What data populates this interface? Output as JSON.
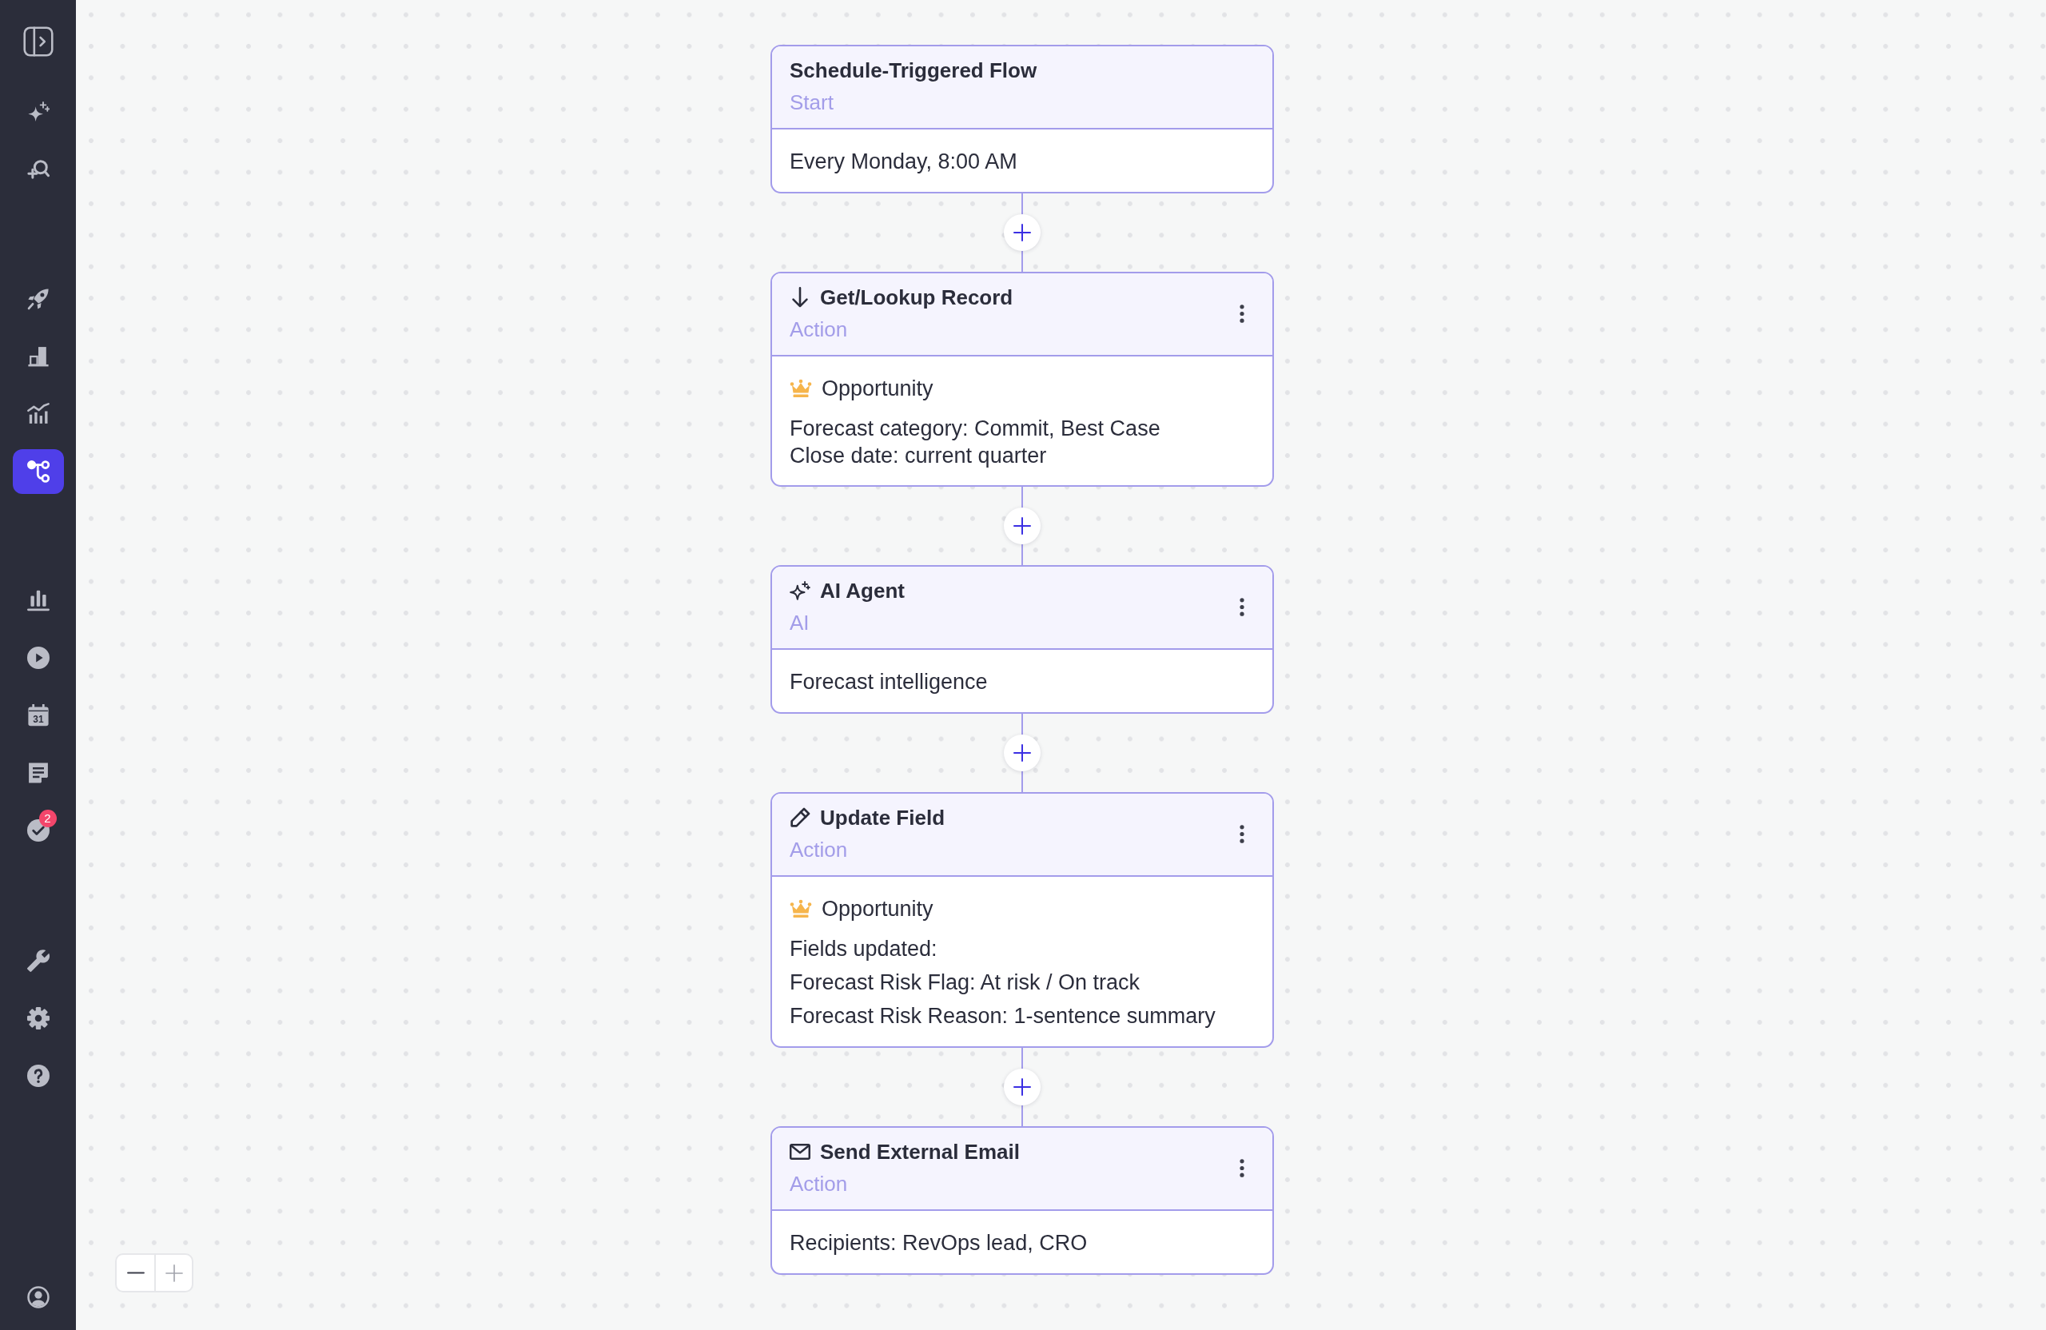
{
  "sidebar": {
    "groups": [
      {
        "items": [
          {
            "kind": "panel_toggle",
            "selected": false
          }
        ]
      },
      {
        "items": [
          {
            "kind": "ai_assistant",
            "selected": false
          },
          {
            "kind": "search_add",
            "selected": false
          }
        ]
      },
      {
        "items": [
          {
            "kind": "launch",
            "selected": false
          },
          {
            "kind": "reports",
            "selected": false
          },
          {
            "kind": "analytics",
            "selected": false
          },
          {
            "kind": "workflows",
            "selected": true
          }
        ]
      },
      {
        "items": [
          {
            "kind": "dashboards",
            "selected": false
          },
          {
            "kind": "recordings",
            "selected": false
          },
          {
            "kind": "calendar",
            "selected": false,
            "icon_text": "31"
          },
          {
            "kind": "notes",
            "selected": false
          },
          {
            "kind": "tasks",
            "selected": false,
            "badge": "2"
          }
        ]
      },
      {
        "items": [
          {
            "kind": "tools",
            "selected": false
          },
          {
            "kind": "settings",
            "selected": false
          },
          {
            "kind": "help",
            "selected": false
          }
        ]
      },
      {
        "items": [
          {
            "kind": "account",
            "selected": false
          }
        ]
      }
    ]
  },
  "flow": {
    "nodes": [
      {
        "kind": "trigger",
        "title": "Schedule-Triggered Flow",
        "type_label": "Start",
        "summary": "Every Monday, 8:00 AM"
      },
      {
        "kind": "lookup",
        "title": "Get/Lookup Record",
        "type_label": "Action",
        "record": "Opportunity",
        "filters": [
          "Forecast category: Commit, Best Case",
          "Close date: current quarter"
        ]
      },
      {
        "kind": "ai",
        "title": "AI Agent",
        "type_label": "AI",
        "summary": "Forecast intelligence"
      },
      {
        "kind": "update",
        "title": "Update Field",
        "type_label": "Action",
        "record": "Opportunity",
        "fields_label": "Fields updated:",
        "fields": [
          "Forecast Risk Flag: At risk / On track",
          "Forecast Risk Reason: 1-sentence summary"
        ]
      },
      {
        "kind": "email",
        "title": "Send External Email",
        "type_label": "Action",
        "summary": "Recipients: RevOps lead, CRO"
      }
    ]
  },
  "zoom_controls": [
    {
      "kind": "zoom_out",
      "disabled": false
    },
    {
      "kind": "zoom_in",
      "disabled": true
    }
  ]
}
